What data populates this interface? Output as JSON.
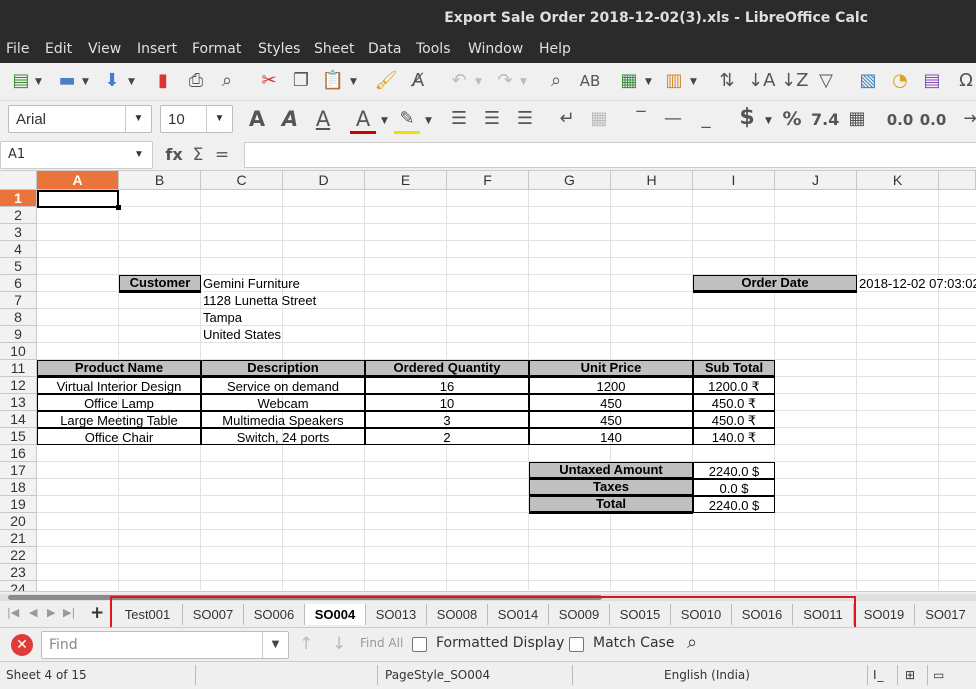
{
  "window": {
    "title": "Export Sale Order 2018-12-02(3).xls - LibreOffice Calc"
  },
  "menu": [
    "File",
    "Edit",
    "View",
    "Insert",
    "Format",
    "Styles",
    "Sheet",
    "Data",
    "Tools",
    "Window",
    "Help"
  ],
  "format": {
    "font_name": "Arial",
    "font_size": "10",
    "currency_symbol": "$",
    "percent_symbol": "%",
    "number_format": "7.4",
    "add_decimal": "0.0",
    "del_decimal": "0.0"
  },
  "formula": {
    "cell_ref": "A1",
    "fx": "fx",
    "sigma": "Σ",
    "equals": "=",
    "content": ""
  },
  "columns": [
    "A",
    "B",
    "C",
    "D",
    "E",
    "F",
    "G",
    "H",
    "I",
    "J",
    "K"
  ],
  "rows": [
    "1",
    "2",
    "3",
    "4",
    "5",
    "6",
    "7",
    "8",
    "9",
    "10",
    "11",
    "12",
    "13",
    "14",
    "15",
    "16",
    "17",
    "18",
    "19",
    "20",
    "21",
    "22",
    "23",
    "24"
  ],
  "sheet": {
    "customer_label": "Customer",
    "customer_name": "Gemini Furniture",
    "address1": "1128 Lunetta Street",
    "address2": "Tampa",
    "address3": "United States",
    "order_date_label": "Order  Date",
    "order_date": "2018-12-02 07:03:02",
    "table_headers": [
      "Product Name",
      "Description",
      "Ordered Quantity",
      "Unit Price",
      "Sub Total"
    ],
    "lines": [
      {
        "product": "Virtual Interior Design",
        "description": "Service on demand",
        "qty": "16",
        "price": "1200",
        "subtotal": "1200.0 ₹"
      },
      {
        "product": "Office Lamp",
        "description": "Webcam",
        "qty": "10",
        "price": "450",
        "subtotal": "450.0 ₹"
      },
      {
        "product": "Large Meeting Table",
        "description": "Multimedia Speakers",
        "qty": "3",
        "price": "450",
        "subtotal": "450.0 ₹"
      },
      {
        "product": "Office Chair",
        "description": "Switch, 24 ports",
        "qty": "2",
        "price": "140",
        "subtotal": "140.0 ₹"
      }
    ],
    "totals": [
      {
        "label": "Untaxed Amount",
        "value": "2240.0 $"
      },
      {
        "label": "Taxes",
        "value": "0.0 $"
      },
      {
        "label": "Total",
        "value": "2240.0 $"
      }
    ]
  },
  "tabs": [
    "Test001",
    "SO007",
    "SO006",
    "SO004",
    "SO013",
    "SO008",
    "SO014",
    "SO009",
    "SO015",
    "SO010",
    "SO016",
    "SO011",
    "SO019",
    "SO017"
  ],
  "active_tab": "SO004",
  "find": {
    "placeholder": "Find",
    "find_all": "Find All",
    "formatted_display": "Formatted Display",
    "match_case": "Match Case"
  },
  "status": {
    "sheet": "Sheet 4 of 15",
    "page_style": "PageStyle_SO004",
    "language": "English (India)"
  },
  "colors": {
    "highlight": "#e9753a",
    "annotation_box": "#e0141e",
    "header_fill": "#c0c0c0"
  }
}
